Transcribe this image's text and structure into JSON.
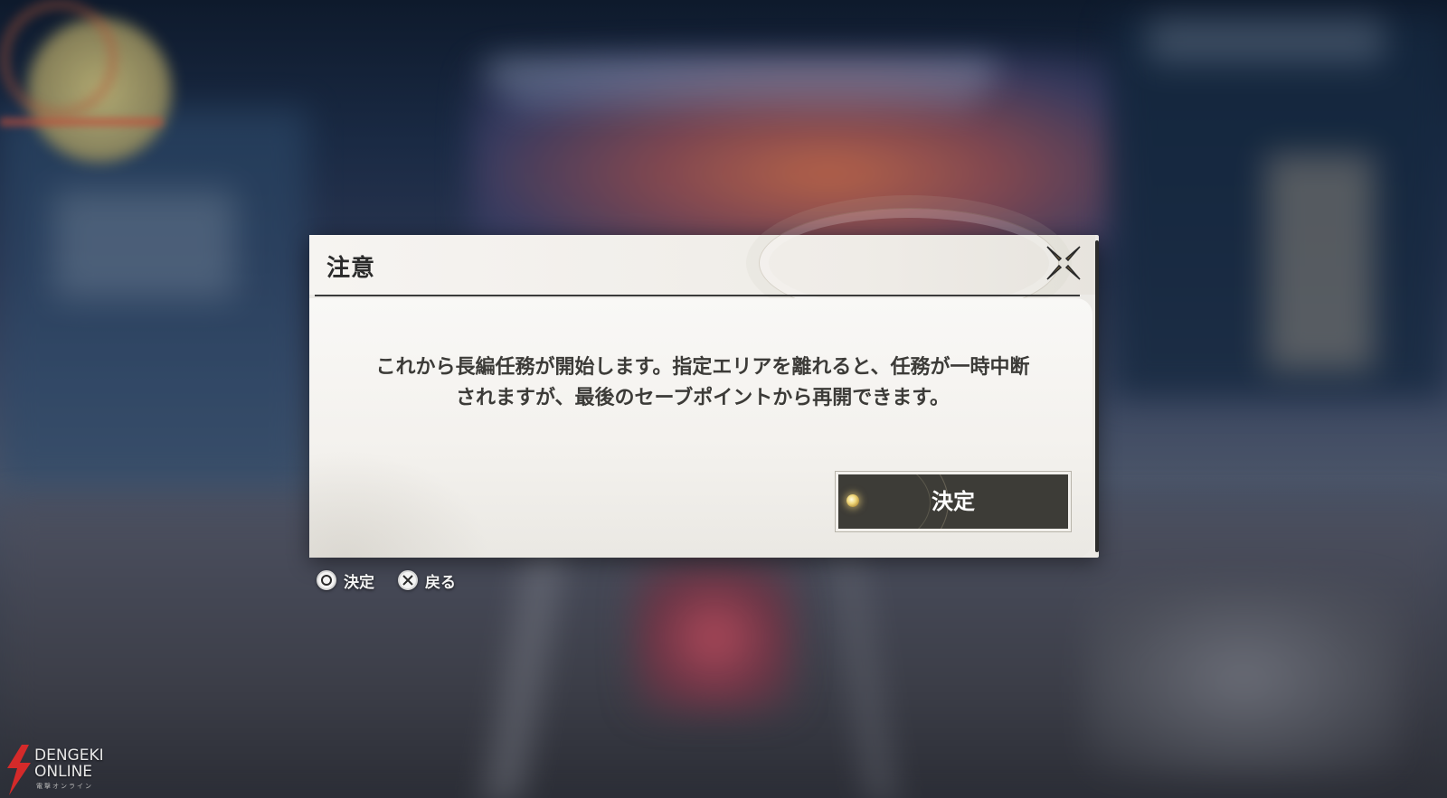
{
  "dialog": {
    "title": "注意",
    "message_line1": "これから長編任務が開始します。指定エリアを離れると、任務が一時中断",
    "message_line2": "されますが、最後のセーブポイントから再開できます。",
    "confirm_label": "決定",
    "close_icon": "close-x-icon"
  },
  "hints": {
    "confirm": {
      "icon": "circle-button-icon",
      "label": "決定"
    },
    "back": {
      "icon": "cross-button-icon",
      "label": "戻る"
    }
  },
  "watermark": {
    "line1": "DENGEKI",
    "line2": "ONLINE",
    "line3": "電撃オンライン"
  },
  "colors": {
    "dialog_bg": "#f5f3f0",
    "button_bg": "#3d3c37",
    "accent_gold": "#8a7448",
    "watermark_red": "#d42a2a"
  }
}
